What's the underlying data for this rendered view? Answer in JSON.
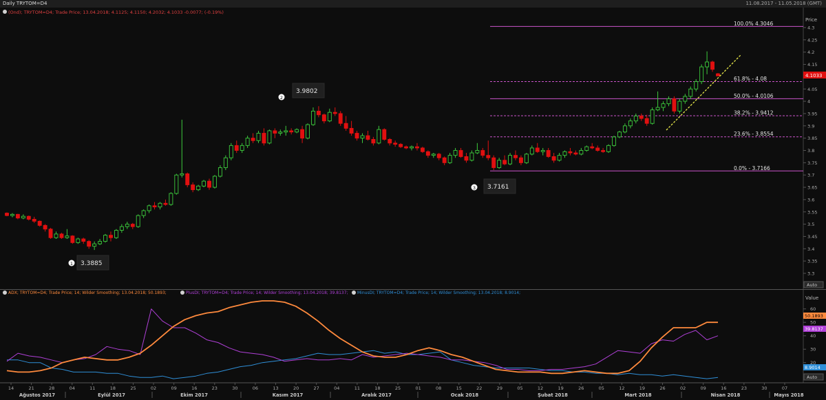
{
  "window": {
    "title": "Daily TRYTOM=D4",
    "date_range": "11.08.2017 - 11.05.2018 (GMT)"
  },
  "colors": {
    "up": "#3dcc3d",
    "down": "#e01010",
    "fib": "#cc55cc",
    "adx": "#ff8a3d",
    "plus_di": "#b040d8",
    "minus_di": "#2f8fd8",
    "trend": "#e8e84a"
  },
  "price_panel": {
    "legend": "(Ond); TRYTOM=D4; Trade Price; 13.04.2018; 4.1125; 4.1150; 4.2032; 4.1033 -0.0077; (-0.19%)",
    "axis_title": "Price",
    "y_ticks": [
      "4.3",
      "4.25",
      "4.2",
      "4.15",
      "4.1",
      "4.05",
      "4",
      "3.95",
      "3.9",
      "3.85",
      "3.8",
      "3.75",
      "3.7",
      "3.65",
      "3.6",
      "3.55",
      "3.5",
      "3.45",
      "3.4",
      "3.35",
      "3.3"
    ],
    "last_label": "4.1033",
    "auto_label": "Auto"
  },
  "fib_levels": [
    {
      "label": "100.0%  4.3046",
      "value": 4.3046
    },
    {
      "label": "61.8%  -  4.08",
      "value": 4.08
    },
    {
      "label": "50.0%  -  4.0106",
      "value": 4.0106
    },
    {
      "label": "38.2%  -  3.9412",
      "value": 3.9412
    },
    {
      "label": "23.6%  -  3.8554",
      "value": 3.8554
    },
    {
      "label": "0.0%  -  3.7166",
      "value": 3.7166
    }
  ],
  "callouts": [
    {
      "marker": "1",
      "value": "3.3885"
    },
    {
      "marker": "2",
      "value": "3.9802"
    },
    {
      "marker": "3",
      "value": "3.7161"
    }
  ],
  "indicator_panel": {
    "legend_adx": "ADX; TRYTOM=D4; Trade Price;  14; Wilder Smoothing; 13.04.2018; 50.1893;",
    "legend_plus": "PlusDI; TRYTOM=D4; Trade Price;  14; Wilder Smoothing; 13.04.2018; 39.8137;",
    "legend_minus": "MinusDI; TRYTOM=D4; Trade Price;  14; Wilder Smoothing; 13.04.2018; 8.9014;",
    "axis_title": "Value",
    "y_ticks": [
      "60",
      "50",
      "40",
      "30",
      "20"
    ],
    "adx_label": "50.1893",
    "plus_label": "39.8137",
    "minus_label": "8.9014",
    "auto_label": "Auto"
  },
  "x_axis": {
    "day_ticks": [
      "14",
      "21",
      "28",
      "04",
      "11",
      "18",
      "25",
      "02",
      "09",
      "16",
      "23",
      "30",
      "06",
      "13",
      "20",
      "27",
      "04",
      "11",
      "18",
      "25",
      "01",
      "08",
      "15",
      "22",
      "29",
      "05",
      "12",
      "19",
      "26",
      "05",
      "12",
      "19",
      "26",
      "02",
      "09",
      "16",
      "23",
      "30",
      "07"
    ],
    "months": [
      "Ağustos 2017",
      "Eylül 2017",
      "Ekim 2017",
      "Kasım 2017",
      "Aralık 2017",
      "Ocak 2018",
      "Şubat 2018",
      "Mart 2018",
      "Nisan 2018",
      "Mayıs 2018"
    ]
  },
  "chart_data": {
    "type": "candlestick",
    "ylim": [
      3.27,
      4.33
    ],
    "candles_ohlc": [
      [
        3.545,
        3.548,
        3.532,
        3.535
      ],
      [
        3.535,
        3.545,
        3.528,
        3.54
      ],
      [
        3.54,
        3.542,
        3.52,
        3.525
      ],
      [
        3.525,
        3.54,
        3.52,
        3.532
      ],
      [
        3.532,
        3.535,
        3.515,
        3.52
      ],
      [
        3.52,
        3.53,
        3.505,
        3.512
      ],
      [
        3.512,
        3.515,
        3.49,
        3.495
      ],
      [
        3.495,
        3.5,
        3.47,
        3.48
      ],
      [
        3.48,
        3.485,
        3.44,
        3.445
      ],
      [
        3.445,
        3.47,
        3.44,
        3.46
      ],
      [
        3.46,
        3.465,
        3.44,
        3.445
      ],
      [
        3.445,
        3.48,
        3.44,
        3.452
      ],
      [
        3.452,
        3.455,
        3.42,
        3.425
      ],
      [
        3.425,
        3.445,
        3.42,
        3.44
      ],
      [
        3.44,
        3.445,
        3.42,
        3.43
      ],
      [
        3.43,
        3.435,
        3.4,
        3.41
      ],
      [
        3.41,
        3.43,
        3.395,
        3.42
      ],
      [
        3.42,
        3.44,
        3.415,
        3.43
      ],
      [
        3.43,
        3.46,
        3.425,
        3.455
      ],
      [
        3.455,
        3.47,
        3.43,
        3.445
      ],
      [
        3.445,
        3.48,
        3.44,
        3.475
      ],
      [
        3.475,
        3.5,
        3.465,
        3.49
      ],
      [
        3.49,
        3.51,
        3.48,
        3.5
      ],
      [
        3.5,
        3.505,
        3.48,
        3.49
      ],
      [
        3.49,
        3.54,
        3.485,
        3.535
      ],
      [
        3.535,
        3.56,
        3.525,
        3.555
      ],
      [
        3.555,
        3.58,
        3.545,
        3.575
      ],
      [
        3.575,
        3.59,
        3.56,
        3.57
      ],
      [
        3.57,
        3.59,
        3.56,
        3.585
      ],
      [
        3.585,
        3.6,
        3.575,
        3.58
      ],
      [
        3.58,
        3.63,
        3.575,
        3.625
      ],
      [
        3.625,
        3.705,
        3.62,
        3.7
      ],
      [
        3.7,
        3.925,
        3.69,
        3.705
      ],
      [
        3.705,
        3.71,
        3.65,
        3.66
      ],
      [
        3.66,
        3.67,
        3.63,
        3.64
      ],
      [
        3.64,
        3.66,
        3.635,
        3.655
      ],
      [
        3.655,
        3.68,
        3.65,
        3.675
      ],
      [
        3.675,
        3.685,
        3.64,
        3.65
      ],
      [
        3.65,
        3.7,
        3.645,
        3.695
      ],
      [
        3.695,
        3.74,
        3.69,
        3.73
      ],
      [
        3.73,
        3.78,
        3.72,
        3.77
      ],
      [
        3.77,
        3.83,
        3.76,
        3.82
      ],
      [
        3.82,
        3.84,
        3.79,
        3.8
      ],
      [
        3.8,
        3.83,
        3.79,
        3.82
      ],
      [
        3.82,
        3.86,
        3.81,
        3.85
      ],
      [
        3.85,
        3.87,
        3.83,
        3.84
      ],
      [
        3.84,
        3.88,
        3.83,
        3.87
      ],
      [
        3.87,
        3.89,
        3.82,
        3.83
      ],
      [
        3.83,
        3.885,
        3.825,
        3.88
      ],
      [
        3.88,
        3.89,
        3.85,
        3.87
      ],
      [
        3.87,
        3.885,
        3.86,
        3.875
      ],
      [
        3.875,
        3.9,
        3.86,
        3.88
      ],
      [
        3.88,
        3.89,
        3.865,
        3.875
      ],
      [
        3.875,
        3.89,
        3.87,
        3.885
      ],
      [
        3.885,
        3.9,
        3.83,
        3.85
      ],
      [
        3.85,
        3.91,
        3.845,
        3.905
      ],
      [
        3.905,
        3.975,
        3.9,
        3.96
      ],
      [
        3.96,
        3.98,
        3.935,
        3.945
      ],
      [
        3.945,
        3.95,
        3.91,
        3.92
      ],
      [
        3.92,
        3.97,
        3.915,
        3.955
      ],
      [
        3.955,
        3.975,
        3.94,
        3.95
      ],
      [
        3.95,
        3.96,
        3.9,
        3.91
      ],
      [
        3.91,
        3.94,
        3.88,
        3.89
      ],
      [
        3.89,
        3.92,
        3.86,
        3.87
      ],
      [
        3.87,
        3.88,
        3.84,
        3.85
      ],
      [
        3.85,
        3.87,
        3.83,
        3.86
      ],
      [
        3.86,
        3.88,
        3.84,
        3.845
      ],
      [
        3.845,
        3.855,
        3.82,
        3.83
      ],
      [
        3.83,
        3.9,
        3.825,
        3.885
      ],
      [
        3.885,
        3.89,
        3.84,
        3.845
      ],
      [
        3.845,
        3.85,
        3.82,
        3.83
      ],
      [
        3.83,
        3.84,
        3.815,
        3.825
      ],
      [
        3.825,
        3.83,
        3.81,
        3.815
      ],
      [
        3.815,
        3.82,
        3.805,
        3.81
      ],
      [
        3.81,
        3.82,
        3.8,
        3.815
      ],
      [
        3.815,
        3.83,
        3.8,
        3.81
      ],
      [
        3.81,
        3.815,
        3.79,
        3.795
      ],
      [
        3.795,
        3.8,
        3.77,
        3.78
      ],
      [
        3.78,
        3.79,
        3.77,
        3.785
      ],
      [
        3.785,
        3.79,
        3.76,
        3.77
      ],
      [
        3.77,
        3.775,
        3.74,
        3.75
      ],
      [
        3.75,
        3.79,
        3.745,
        3.78
      ],
      [
        3.78,
        3.81,
        3.77,
        3.8
      ],
      [
        3.8,
        3.81,
        3.77,
        3.775
      ],
      [
        3.775,
        3.79,
        3.75,
        3.76
      ],
      [
        3.76,
        3.8,
        3.755,
        3.79
      ],
      [
        3.79,
        3.83,
        3.785,
        3.8
      ],
      [
        3.8,
        3.81,
        3.77,
        3.78
      ],
      [
        3.78,
        3.84,
        3.76,
        3.77
      ],
      [
        3.77,
        3.78,
        3.72,
        3.73
      ],
      [
        3.73,
        3.77,
        3.725,
        3.76
      ],
      [
        3.76,
        3.78,
        3.74,
        3.745
      ],
      [
        3.745,
        3.79,
        3.74,
        3.78
      ],
      [
        3.78,
        3.8,
        3.76,
        3.77
      ],
      [
        3.77,
        3.78,
        3.74,
        3.75
      ],
      [
        3.75,
        3.79,
        3.745,
        3.785
      ],
      [
        3.785,
        3.82,
        3.78,
        3.81
      ],
      [
        3.81,
        3.83,
        3.79,
        3.795
      ],
      [
        3.795,
        3.81,
        3.78,
        3.8
      ],
      [
        3.8,
        3.81,
        3.77,
        3.775
      ],
      [
        3.775,
        3.79,
        3.75,
        3.76
      ],
      [
        3.76,
        3.79,
        3.755,
        3.78
      ],
      [
        3.78,
        3.8,
        3.77,
        3.795
      ],
      [
        3.795,
        3.81,
        3.78,
        3.79
      ],
      [
        3.79,
        3.8,
        3.78,
        3.785
      ],
      [
        3.785,
        3.81,
        3.78,
        3.8
      ],
      [
        3.8,
        3.82,
        3.795,
        3.815
      ],
      [
        3.815,
        3.83,
        3.805,
        3.81
      ],
      [
        3.81,
        3.82,
        3.795,
        3.8
      ],
      [
        3.8,
        3.81,
        3.79,
        3.795
      ],
      [
        3.795,
        3.825,
        3.79,
        3.82
      ],
      [
        3.82,
        3.86,
        3.815,
        3.855
      ],
      [
        3.855,
        3.88,
        3.85,
        3.875
      ],
      [
        3.875,
        3.91,
        3.87,
        3.9
      ],
      [
        3.9,
        3.93,
        3.89,
        3.92
      ],
      [
        3.92,
        3.95,
        3.91,
        3.94
      ],
      [
        3.94,
        3.95,
        3.92,
        3.93
      ],
      [
        3.93,
        3.945,
        3.9,
        3.91
      ],
      [
        3.91,
        3.975,
        3.905,
        3.965
      ],
      [
        3.965,
        4.04,
        3.96,
        3.975
      ],
      [
        3.975,
        4.0,
        3.96,
        3.99
      ],
      [
        3.99,
        4.02,
        3.98,
        4.01
      ],
      [
        4.01,
        4.02,
        3.95,
        3.96
      ],
      [
        3.96,
        4.01,
        3.95,
        4.0
      ],
      [
        4.0,
        4.03,
        3.99,
        4.02
      ],
      [
        4.02,
        4.06,
        4.01,
        4.05
      ],
      [
        4.05,
        4.09,
        4.04,
        4.08
      ],
      [
        4.08,
        4.15,
        4.07,
        4.14
      ],
      [
        4.14,
        4.203,
        4.11,
        4.16
      ],
      [
        4.16,
        4.165,
        4.12,
        4.13
      ],
      [
        4.112,
        4.115,
        4.103,
        4.103
      ]
    ],
    "adx": [
      14,
      13,
      13,
      14,
      16,
      20,
      22,
      24,
      23,
      22,
      22,
      24,
      27,
      33,
      40,
      47,
      52,
      55,
      57,
      58,
      61,
      63,
      65,
      66,
      66,
      65,
      62,
      57,
      51,
      44,
      38,
      33,
      28,
      25,
      24,
      24,
      26,
      29,
      31,
      29,
      26,
      24,
      21,
      18,
      15,
      14,
      13,
      13,
      13,
      12,
      12,
      13,
      14,
      13,
      12,
      12,
      14,
      21,
      31,
      39,
      46,
      46,
      46,
      50,
      50
    ],
    "plus_di": [
      21,
      27,
      25,
      24,
      22,
      20,
      22,
      23,
      26,
      32,
      30,
      29,
      26,
      60,
      51,
      46,
      46,
      42,
      37,
      35,
      31,
      28,
      27,
      26,
      24,
      21,
      22,
      23,
      22,
      22,
      23,
      22,
      26,
      24,
      25,
      26,
      27,
      26,
      25,
      24,
      22,
      22,
      21,
      20,
      18,
      15,
      15,
      14,
      14,
      15,
      15,
      16,
      17,
      19,
      24,
      29,
      28,
      27,
      34,
      37,
      36,
      41,
      44,
      37,
      40
    ],
    "minus_di": [
      22,
      22,
      20,
      20,
      16,
      15,
      13,
      13,
      13,
      12,
      12,
      10,
      9,
      9,
      10,
      8,
      9,
      10,
      12,
      13,
      15,
      17,
      18,
      20,
      21,
      22,
      23,
      25,
      27,
      26,
      26,
      27,
      28,
      29,
      27,
      28,
      26,
      26,
      27,
      28,
      22,
      20,
      18,
      17,
      16,
      16,
      16,
      16,
      15,
      14,
      14,
      13,
      13,
      12,
      12,
      11,
      12,
      11,
      11,
      10,
      11,
      10,
      9,
      8,
      9
    ],
    "indicator_ylim": [
      5,
      66
    ]
  }
}
